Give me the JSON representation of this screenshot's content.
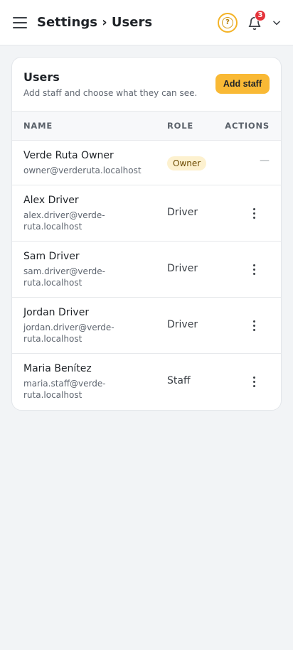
{
  "header": {
    "title": "Settings › Users",
    "notification_count": "3",
    "icons": [
      "menu-icon",
      "help-icon",
      "bell-icon",
      "chevron-down-icon"
    ]
  },
  "card": {
    "title": "Users",
    "subtitle": "Add staff and choose what they can see.",
    "add_button": "Add staff",
    "columns": {
      "name": "NAME",
      "role": "ROLE",
      "actions": "ACTIONS"
    },
    "users": [
      {
        "name": "Verde Ruta Owner",
        "email": "owner@verderuta.localhost",
        "role": "Owner",
        "actions": "—"
      },
      {
        "name": "Alex Driver",
        "email": "alex.driver@verde-ruta.localhost",
        "role": "Driver"
      },
      {
        "name": "Sam Driver",
        "email": "sam.driver@verde-ruta.localhost",
        "role": "Driver"
      },
      {
        "name": "Jordan Driver",
        "email": "jordan.driver@verde-ruta.localhost",
        "role": "Driver"
      },
      {
        "name": "Maria Benítez",
        "email": "maria.staff@verde-ruta.localhost",
        "role": "Staff"
      }
    ]
  },
  "colors": {
    "accent": "#f9b935",
    "badge": "#e5343b",
    "owner_pill": "#fdf1cf",
    "background": "#f2f4f6"
  }
}
